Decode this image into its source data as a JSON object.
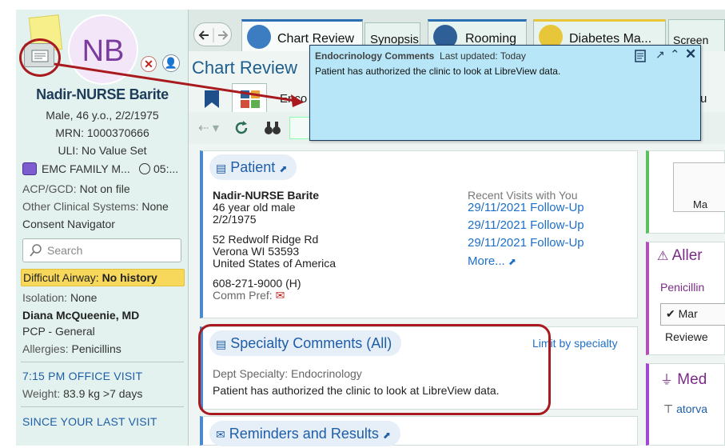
{
  "sidebar": {
    "avatar_initials": "NB",
    "patient_name": "Nadir-NURSE Barite",
    "demographics": "Male, 46 y.o., 2/2/1975",
    "mrn": "MRN: 1000370666",
    "uli": "ULI: No Value Set",
    "department": "EMC FAMILY M...",
    "dept_time": "05:...",
    "acp_label": "ACP/GCD:",
    "acp_value": "Not on file",
    "other_systems_label": "Other Clinical Systems:",
    "other_systems_value": "None",
    "consent_navigator": "Consent Navigator",
    "search_placeholder": "Search",
    "airway_label": "Difficult Airway:",
    "airway_value": "No history",
    "isolation_label": "Isolation:",
    "isolation_value": "None",
    "provider": "Diana McQueenie, MD",
    "pcp": "PCP - General",
    "allergies_label": "Allergies:",
    "allergies_value": "Penicillins",
    "visit_header": "7:15 PM OFFICE VISIT",
    "weight_label": "Weight:",
    "weight_value": "83.9 kg >7 days",
    "since_last_visit": "SINCE YOUR LAST VISIT"
  },
  "tabs": [
    {
      "label": "Chart Review"
    },
    {
      "label": "Synopsis"
    },
    {
      "label": "Rooming"
    },
    {
      "label": "Diabetes Ma..."
    },
    {
      "label": "Screen"
    }
  ],
  "main": {
    "title": "Chart Review",
    "subtab_partial": "Enco",
    "subtab_partial_right": "u"
  },
  "popup": {
    "title": "Endocrinology Comments",
    "updated": "Last updated: Today",
    "body": "Patient has authorized the clinic to look at LibreView data."
  },
  "patient_card": {
    "heading": "Patient",
    "name": "Nadir-NURSE Barite",
    "age_sex": "46 year old male",
    "dob": "2/2/1975",
    "address1": "52 Redwolf Ridge Rd",
    "address2": "Verona WI 53593",
    "address3": "United States of America",
    "phone": "608-271-9000 (H)",
    "comm_pref": "Comm Pref:",
    "recent_visits_label": "Recent Visits with You",
    "visits": [
      "29/11/2021 Follow-Up",
      "29/11/2021 Follow-Up",
      "29/11/2021 Follow-Up"
    ],
    "more": "More..."
  },
  "specialty_card": {
    "heading": "Specialty Comments (All)",
    "limit_link": "Limit by specialty",
    "dept": "Dept Specialty: Endocrinology",
    "comment": "Patient has authorized the clinic to look at LibreView data."
  },
  "reminders_card": {
    "heading": "Reminders and Results"
  },
  "right_cards": {
    "rc1_text": "Ma",
    "allergies_head": "Aller",
    "allergies_item": "Penicillin",
    "mark_button": "Mar",
    "reviewed": "Reviewe",
    "meds_head": "Med",
    "meds_item": "atorva"
  },
  "colors": {
    "annotation": "#a91a1e",
    "popup_bg": "#b6e6f7",
    "link": "#1e6fc8",
    "sidebar_bg": "#e3f2ee"
  }
}
